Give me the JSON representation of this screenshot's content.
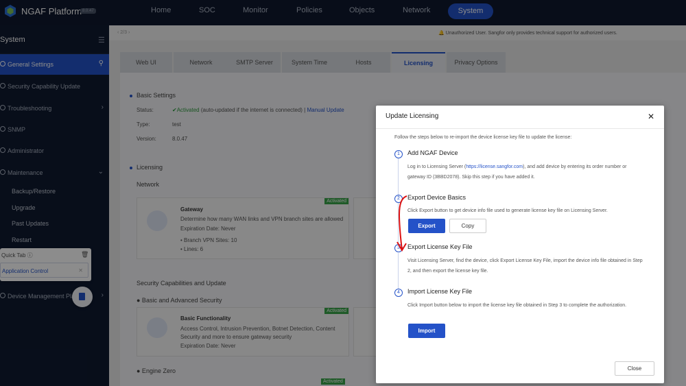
{
  "topbar": {
    "brand": "NGAF Platform",
    "version": "8.0.47",
    "nav": [
      "Home",
      "SOC",
      "Monitor",
      "Policies",
      "Objects",
      "Network",
      "System"
    ],
    "active_nav": "System"
  },
  "sidebar": {
    "title": "System",
    "items": [
      {
        "label": "General Settings"
      },
      {
        "label": "Security Capability Update"
      },
      {
        "label": "Troubleshooting"
      },
      {
        "label": "SNMP"
      },
      {
        "label": "Administrator"
      },
      {
        "label": "Maintenance"
      },
      {
        "label": "Device Management Pla"
      }
    ],
    "subitems": [
      "Backup/Restore",
      "Upgrade",
      "Past Updates",
      "Restart"
    ],
    "quick_tab": {
      "title": "Quick Tab",
      "item": "Application Control"
    }
  },
  "crumb": "2/3",
  "notice": "Unauthorized User. Sangfor only provides technical support for authorized users.",
  "tabs": [
    "Web UI",
    "Network",
    "SMTP Server",
    "System Time",
    "Hosts",
    "Licensing",
    "Privacy Options"
  ],
  "basic": {
    "section": "Basic Settings",
    "status_label": "Status:",
    "status_value": "Activated",
    "status_note": "(auto-updated if the internet is connected)",
    "manual": "Manual Update",
    "type_label": "Type:",
    "type_value": "test",
    "version_label": "Version:",
    "version_value": "8.0.47"
  },
  "licensing": {
    "section": "Licensing",
    "network": "Network",
    "badge": "Activated",
    "gateway_title": "Gateway",
    "gateway_desc": "Determine how many WAN links and VPN branch sites are allowed",
    "gateway_exp": "Expiration Date: Never",
    "branch": "• Branch VPN Sites: 10",
    "lines": "• Lines: 6",
    "sec_cap": "Security Capabilities and Update",
    "basic_adv": "● Basic and Advanced Security",
    "basic_func": "Basic Functionality",
    "basic_desc": "Access Control, Intrusion Prevention, Botnet Detection, Content Security and more to ensure gateway security",
    "basic_exp": "Expiration Date: Never",
    "engine_zero": "● Engine Zero"
  },
  "modal": {
    "title": "Update Licensing",
    "intro": "Follow the steps below to re-import the device license key file to update the license:",
    "steps": [
      {
        "num": "1",
        "title": "Add NGAF Device",
        "desc_pre": "Log in to Licensing Server (",
        "desc_link": "https://license.sangfor.com",
        "desc_post": "), and add device by entering its order number or gateway ID (3BBD2078). Skip this step if you have added it."
      },
      {
        "num": "2",
        "title": "Export Device Basics",
        "desc": "Click Export button to get device info file used to generate license key file on Licensing Server."
      },
      {
        "num": "3",
        "title": "Export License Key File",
        "desc": "Visit Licensing Server, find the device, click Export License Key File, import the device info file obtained in Step 2, and then export the license key file."
      },
      {
        "num": "4",
        "title": "Import License Key File",
        "desc": "Click Import button below to import the license key file obtained in Step 3 to complete the authorization."
      }
    ],
    "export_btn": "Export",
    "copy_btn": "Copy",
    "import_btn": "Import",
    "close_btn": "Close"
  },
  "colors": {
    "primary": "#2452c8",
    "success": "#3aa54a",
    "dark": "#10192e"
  }
}
